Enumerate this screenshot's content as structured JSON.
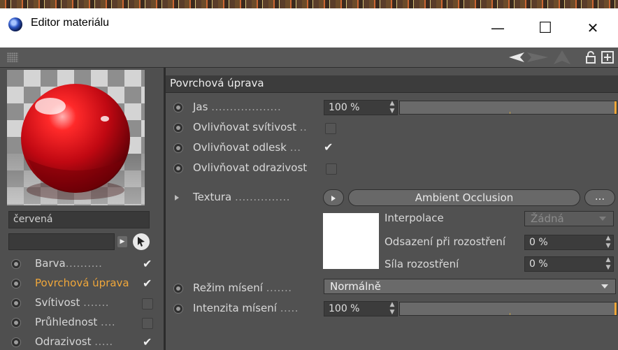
{
  "window": {
    "title": "Editor materiálu",
    "controls": {
      "minimize": "—",
      "maximize": "☐",
      "close": "✕"
    }
  },
  "toolbar": {
    "icons": [
      "grip-icon",
      "back-arrow-icon",
      "forward-arrow-icon",
      "up-arrow-icon",
      "lock-icon",
      "new-panel-icon"
    ]
  },
  "material": {
    "name": "červená",
    "preview_color": "#d7141d"
  },
  "channels": [
    {
      "label": "Barva",
      "dots": "..........",
      "checked": true,
      "active": false
    },
    {
      "label": "Povrchová úprava",
      "dots": "",
      "checked": true,
      "active": true
    },
    {
      "label": "Svítivost",
      "dots": ".......",
      "checked": false,
      "active": false
    },
    {
      "label": "Průhlednost",
      "dots": "....",
      "checked": false,
      "active": false
    },
    {
      "label": "Odrazivost",
      "dots": ".....",
      "checked": true,
      "active": false
    }
  ],
  "section": {
    "title": "Povrchová úprava",
    "jas": {
      "label": "Jas",
      "dots": "...................",
      "value": "100 %",
      "slider_fraction": 1.0
    },
    "ovlivnovat_svitivost": {
      "label": "Ovlivňovat svítivost",
      "dots": "..",
      "checked": false
    },
    "ovlivnovat_odlesk": {
      "label": "Ovlivňovat odlesk",
      "dots": "...",
      "checked": true
    },
    "ovlivnovat_odrazivost": {
      "label": "Ovlivňovat odrazivost",
      "checked": false
    },
    "textura": {
      "label": "Textura",
      "dots": "...............",
      "shader": "Ambient Occlusion",
      "more_button": "...",
      "interpolace": {
        "label": "Interpolace",
        "value": "Žádná"
      },
      "odsazeni": {
        "label": "Odsazení při rozostření",
        "value": "0 %"
      },
      "sila": {
        "label": "Síla rozostření",
        "value": "0 %"
      }
    },
    "rezim_miseni": {
      "label": "Režim mísení",
      "dots": ".......",
      "value": "Normálně"
    },
    "intenzita_miseni": {
      "label": "Intenzita mísení",
      "dots": ".....",
      "value": "100 %",
      "slider_fraction": 1.0
    }
  },
  "colors": {
    "accent": "#f0a73a",
    "panel": "#515151",
    "field": "#3c3c3c"
  }
}
